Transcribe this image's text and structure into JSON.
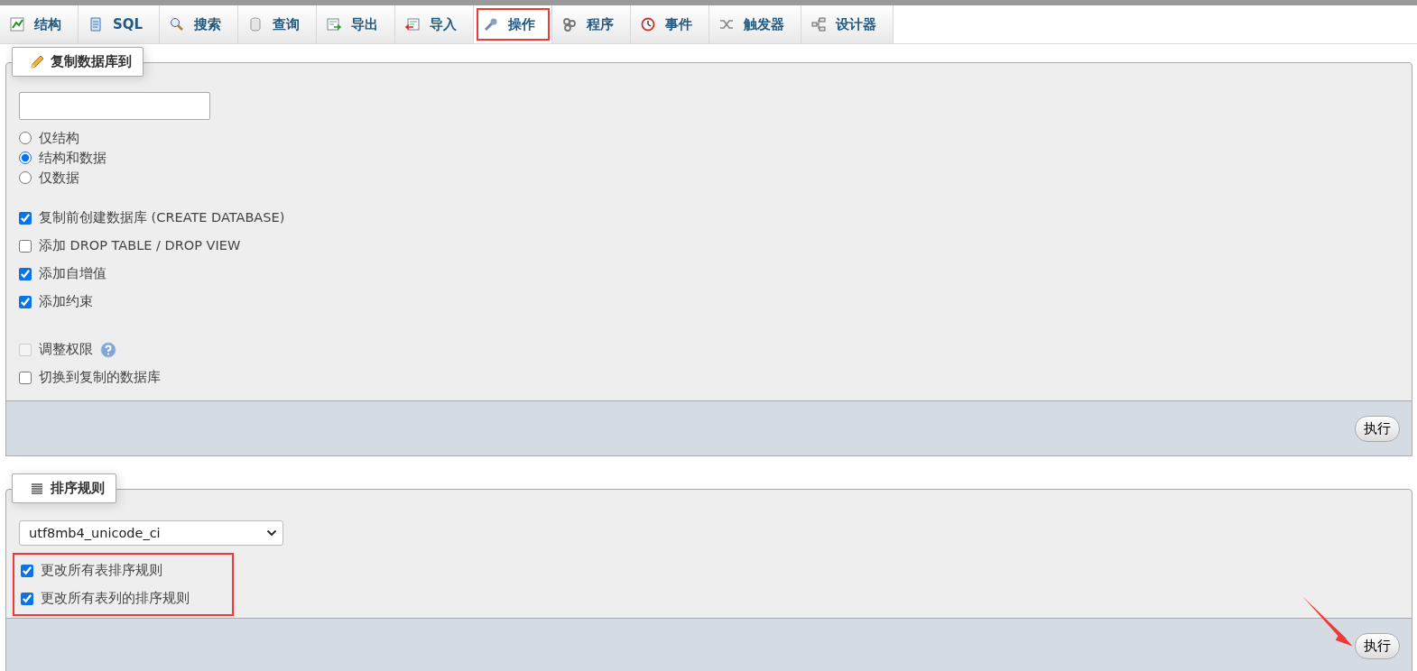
{
  "tabs": [
    {
      "label": "结构",
      "selected": false,
      "highlighted": false
    },
    {
      "label": "SQL",
      "selected": false,
      "highlighted": false
    },
    {
      "label": "搜索",
      "selected": false,
      "highlighted": false
    },
    {
      "label": "查询",
      "selected": false,
      "highlighted": false
    },
    {
      "label": "导出",
      "selected": false,
      "highlighted": false
    },
    {
      "label": "导入",
      "selected": false,
      "highlighted": false
    },
    {
      "label": "操作",
      "selected": true,
      "highlighted": true
    },
    {
      "label": "程序",
      "selected": false,
      "highlighted": false
    },
    {
      "label": "事件",
      "selected": false,
      "highlighted": false
    },
    {
      "label": "触发器",
      "selected": false,
      "highlighted": false
    },
    {
      "label": "设计器",
      "selected": false,
      "highlighted": false
    }
  ],
  "copy_section": {
    "legend": "复制数据库到",
    "radios": [
      {
        "label": "仅结构",
        "selected": false
      },
      {
        "label": "结构和数据",
        "selected": true
      },
      {
        "label": "仅数据",
        "selected": false
      }
    ],
    "option_groups": [
      [
        {
          "label": "复制前创建数据库 (CREATE DATABASE)",
          "checked": true,
          "disabled": false,
          "help": false
        },
        {
          "label": "添加 DROP TABLE / DROP VIEW",
          "checked": false,
          "disabled": false,
          "help": false
        },
        {
          "label": "添加自增值",
          "checked": true,
          "disabled": false,
          "help": false
        },
        {
          "label": "添加约束",
          "checked": true,
          "disabled": false,
          "help": false
        }
      ],
      [
        {
          "label": "调整权限",
          "checked": false,
          "disabled": true,
          "help": true
        },
        {
          "label": "切换到复制的数据库",
          "checked": false,
          "disabled": false,
          "help": false
        }
      ]
    ],
    "button": "执行"
  },
  "collation_section": {
    "legend": "排序规则",
    "select_value": "utf8mb4_unicode_ci",
    "options": [
      {
        "label": "更改所有表排序规则",
        "checked": true
      },
      {
        "label": "更改所有表列的排序规则",
        "checked": true
      }
    ],
    "options_highlighted": true,
    "arrow_to_button": true,
    "button": "执行"
  }
}
